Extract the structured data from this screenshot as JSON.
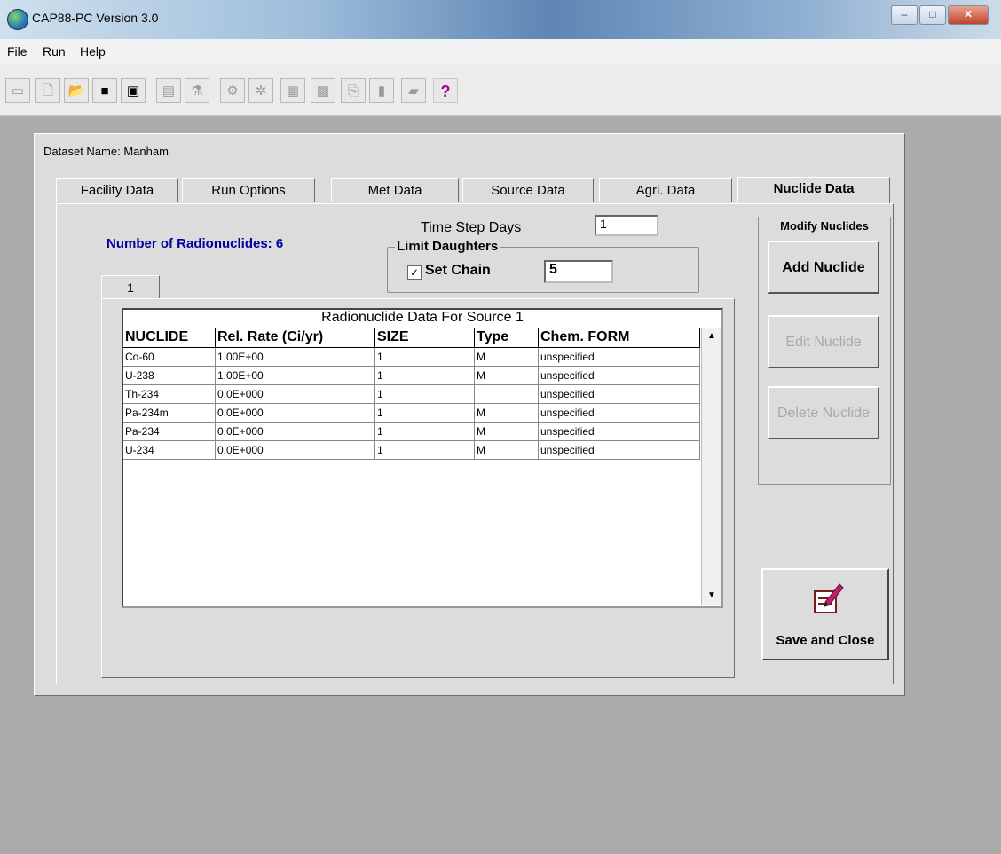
{
  "window": {
    "title": "CAP88-PC Version 3.0"
  },
  "menu": [
    "File",
    "Run",
    "Help"
  ],
  "toolbar": {
    "icons": [
      "new-icon",
      "open-icon",
      "save-icon",
      "print-icon",
      "report-icon",
      "chart-icon",
      "calc-icon",
      "run-icon",
      "wind-icon",
      "map-icon",
      "grid-icon",
      "export-icon",
      "help-icon"
    ],
    "help_label": "?"
  },
  "dataset": {
    "label": "Dataset Name: Manham"
  },
  "tabs": [
    "Facility Data",
    "Run Options",
    "Met Data",
    "Source Data",
    "Agri. Data",
    "Nuclide Data"
  ],
  "active_tab": "Nuclide Data",
  "nuclide": {
    "count_label": "Number of Radionuclides: 6",
    "time_step_label": "Time Step Days",
    "time_step_value": "1",
    "limit_group_label": "Limit Daughters",
    "set_chain_label": "Set Chain",
    "set_chain_checked": true,
    "set_chain_value": "5",
    "source_tab_label": "1",
    "grid_title": "Radionuclide Data For Source 1",
    "columns": [
      "NUCLIDE",
      "Rel. Rate (Ci/yr)",
      "SIZE",
      "Type",
      "Chem. FORM"
    ],
    "rows": [
      [
        "Co-60",
        "1.00E+00",
        "1",
        "M",
        "unspecified"
      ],
      [
        "U-238",
        "1.00E+00",
        "1",
        "M",
        "unspecified"
      ],
      [
        "Th-234",
        "0.0E+000",
        "1",
        "",
        "unspecified"
      ],
      [
        "Pa-234m",
        "0.0E+000",
        "1",
        "M",
        "unspecified"
      ],
      [
        "Pa-234",
        "0.0E+000",
        "1",
        "M",
        "unspecified"
      ],
      [
        "U-234",
        "0.0E+000",
        "1",
        "M",
        "unspecified"
      ]
    ],
    "modify_group_label": "Modify Nuclides",
    "add_label": "Add Nuclide",
    "edit_label": "Edit Nuclide",
    "delete_label": "Delete Nuclide",
    "save_close_label": "Save and Close"
  }
}
